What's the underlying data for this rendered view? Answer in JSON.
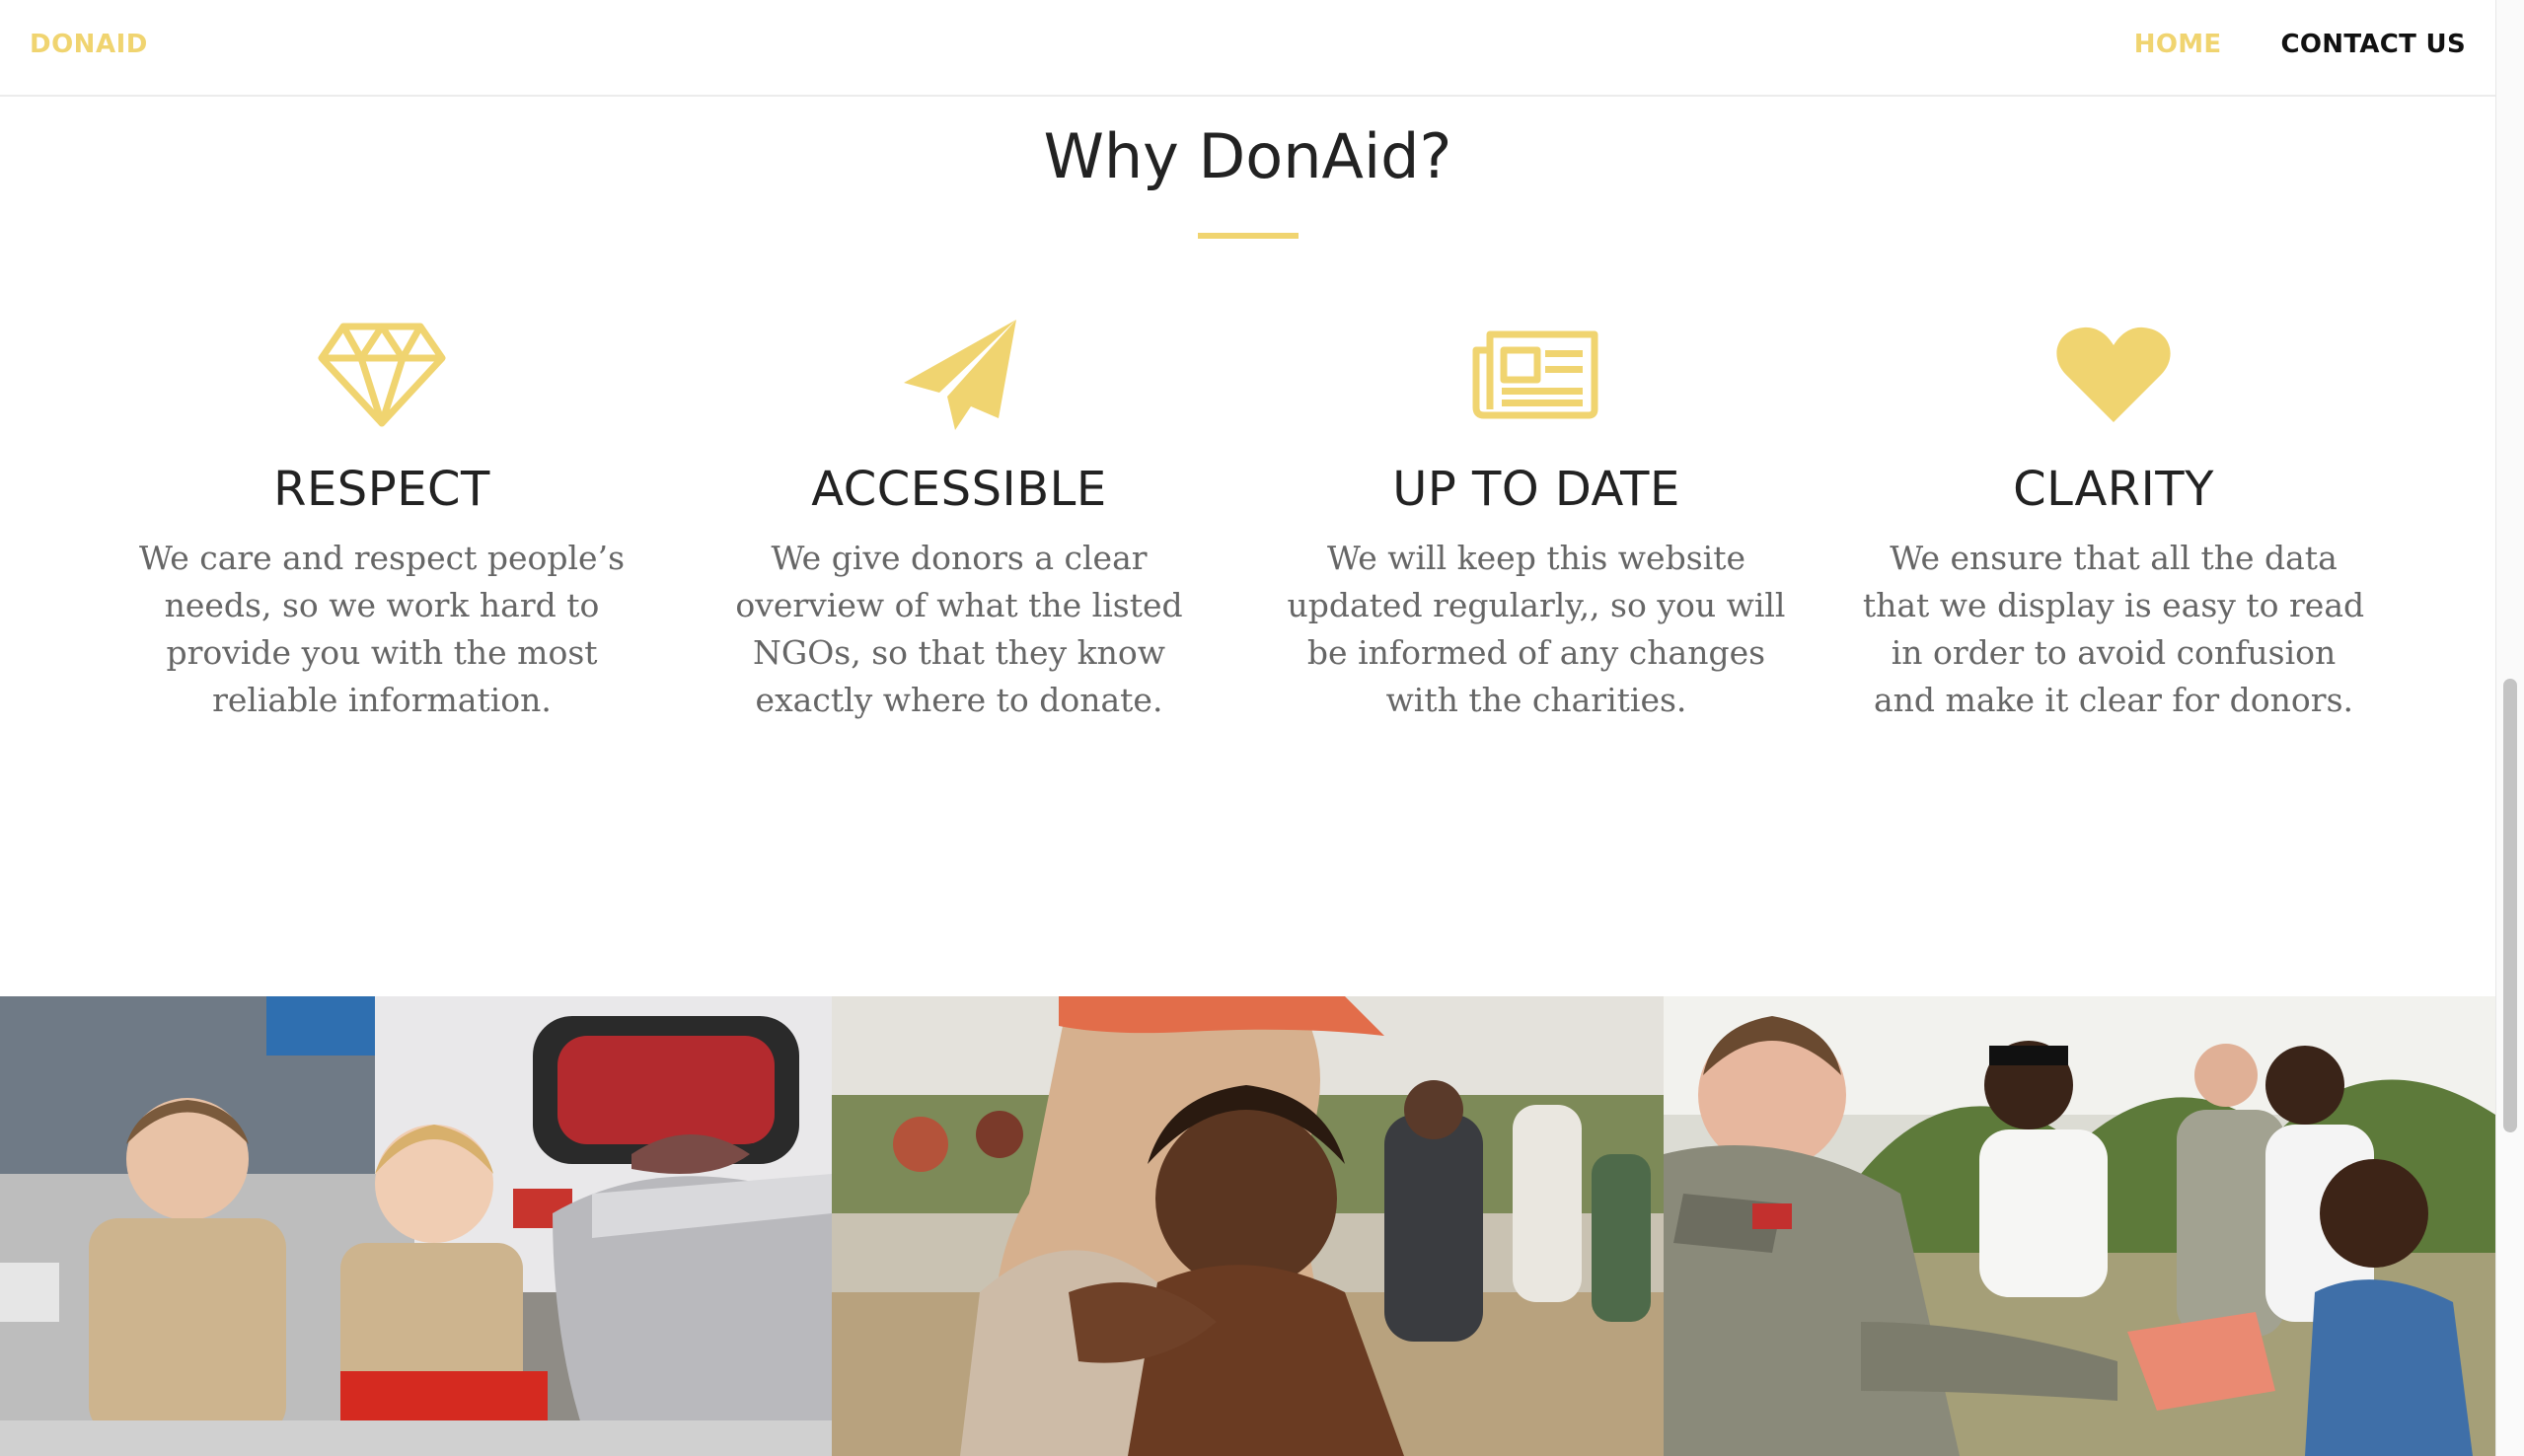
{
  "nav": {
    "brand": "DONAID",
    "links": [
      {
        "label": "HOME",
        "active": true
      },
      {
        "label": "CONTACT US",
        "active": false
      }
    ]
  },
  "section": {
    "title": "Why DonAid?"
  },
  "features": [
    {
      "icon": "diamond-icon",
      "title": "RESPECT",
      "text": "We care and respect people’s needs, so we work hard to provide you with the most reliable information."
    },
    {
      "icon": "paper-plane-icon",
      "title": "ACCESSIBLE",
      "text": "We give donors a clear overview of what the listed NGOs, so that they know exactly where to donate."
    },
    {
      "icon": "newspaper-icon",
      "title": "UP TO DATE",
      "text": "We will keep this website updated regularly,, so you will be informed of any changes with the charities."
    },
    {
      "icon": "heart-icon",
      "title": "CLARITY",
      "text": "We ensure that all the data that we display is easy to read in order to avoid confusion and make it clear for donors."
    }
  ],
  "colors": {
    "accent": "#f0d470",
    "heading": "#222222",
    "body_text": "#666666"
  },
  "photos": [
    {
      "subject": "children-ambulance-photo"
    },
    {
      "subject": "woman-holding-child-photo"
    },
    {
      "subject": "soldier-giving-package-photo"
    }
  ]
}
